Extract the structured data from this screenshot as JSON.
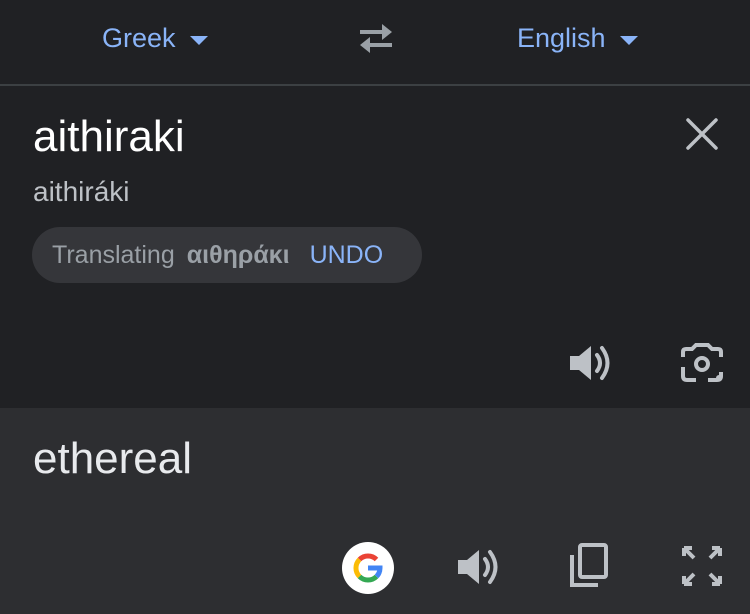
{
  "language_bar": {
    "source_language": "Greek",
    "target_language": "English"
  },
  "input": {
    "text": "aithiraki",
    "transliteration": "aithiráki",
    "suggestion_chip": {
      "prefix": "Translating",
      "suggested_text": "αιθηράκι",
      "action_label": "UNDO"
    }
  },
  "output": {
    "text": "ethereal"
  },
  "icons": {
    "swap": "swap-languages-icon",
    "clear": "close-icon",
    "listen_source": "speaker-icon",
    "camera": "camera-lens-icon",
    "google": "google-logo-icon",
    "listen_translation": "speaker-icon",
    "copy": "copy-icon",
    "fullscreen": "fullscreen-icon"
  },
  "colors": {
    "background": "#202124",
    "output_background": "#2d2e31",
    "accent": "#8ab4f8",
    "chip_background": "#35363a"
  }
}
